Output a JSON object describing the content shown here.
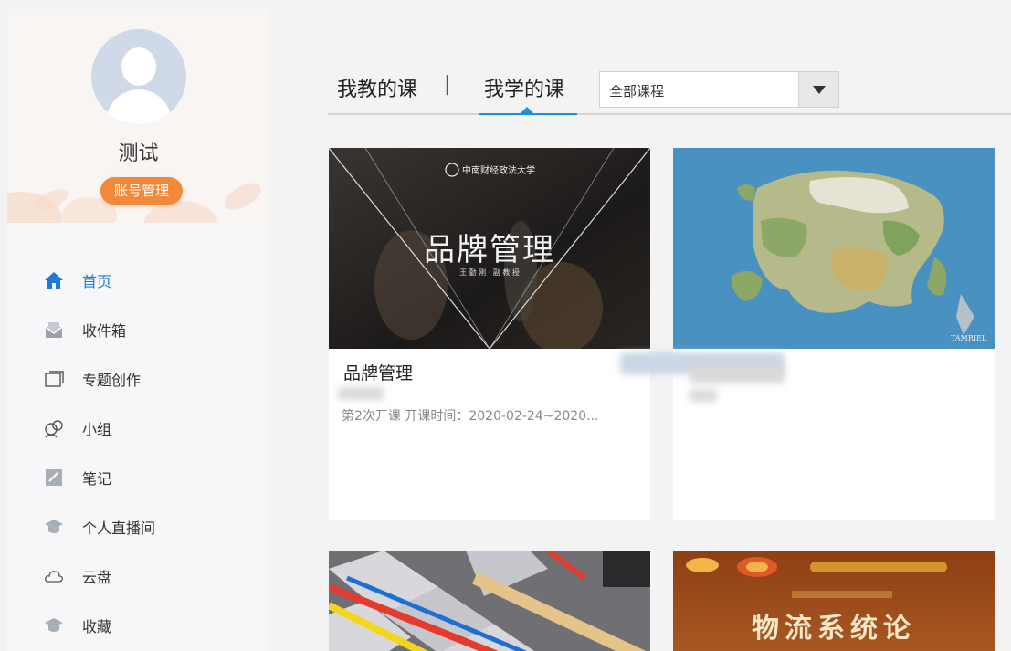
{
  "profile": {
    "username": "测试",
    "account_button": "账号管理"
  },
  "sidebar": {
    "items": [
      {
        "label": "首页",
        "icon": "home-icon",
        "active": true
      },
      {
        "label": "收件箱",
        "icon": "inbox-icon"
      },
      {
        "label": "专题创作",
        "icon": "topic-icon"
      },
      {
        "label": "小组",
        "icon": "group-icon"
      },
      {
        "label": "笔记",
        "icon": "note-icon"
      },
      {
        "label": "个人直播间",
        "icon": "live-icon"
      },
      {
        "label": "云盘",
        "icon": "cloud-icon"
      },
      {
        "label": "收藏",
        "icon": "favorite-icon"
      }
    ]
  },
  "tabs": {
    "teach": "我教的课",
    "separator": "|",
    "learn": "我学的课",
    "filter_value": "全部课程"
  },
  "courses": [
    {
      "title": "品牌管理",
      "meta": "第2次开课 开课时间：2020-02-24~2020...",
      "thumb_school": "中南财经政法大学",
      "thumb_title": "品牌管理",
      "thumb_teacher": "王 勤 刚 · 副 教 授"
    },
    {
      "title": "",
      "meta": "",
      "thumb_label": "TAMRIEL"
    },
    {
      "title": "",
      "meta": ""
    },
    {
      "title": "",
      "meta": "",
      "thumb_title": "物流系统论"
    }
  ],
  "colors": {
    "accent": "#1f7bd6",
    "account_button": "#f08a3a",
    "tab_underline": "#1e8fe0"
  }
}
